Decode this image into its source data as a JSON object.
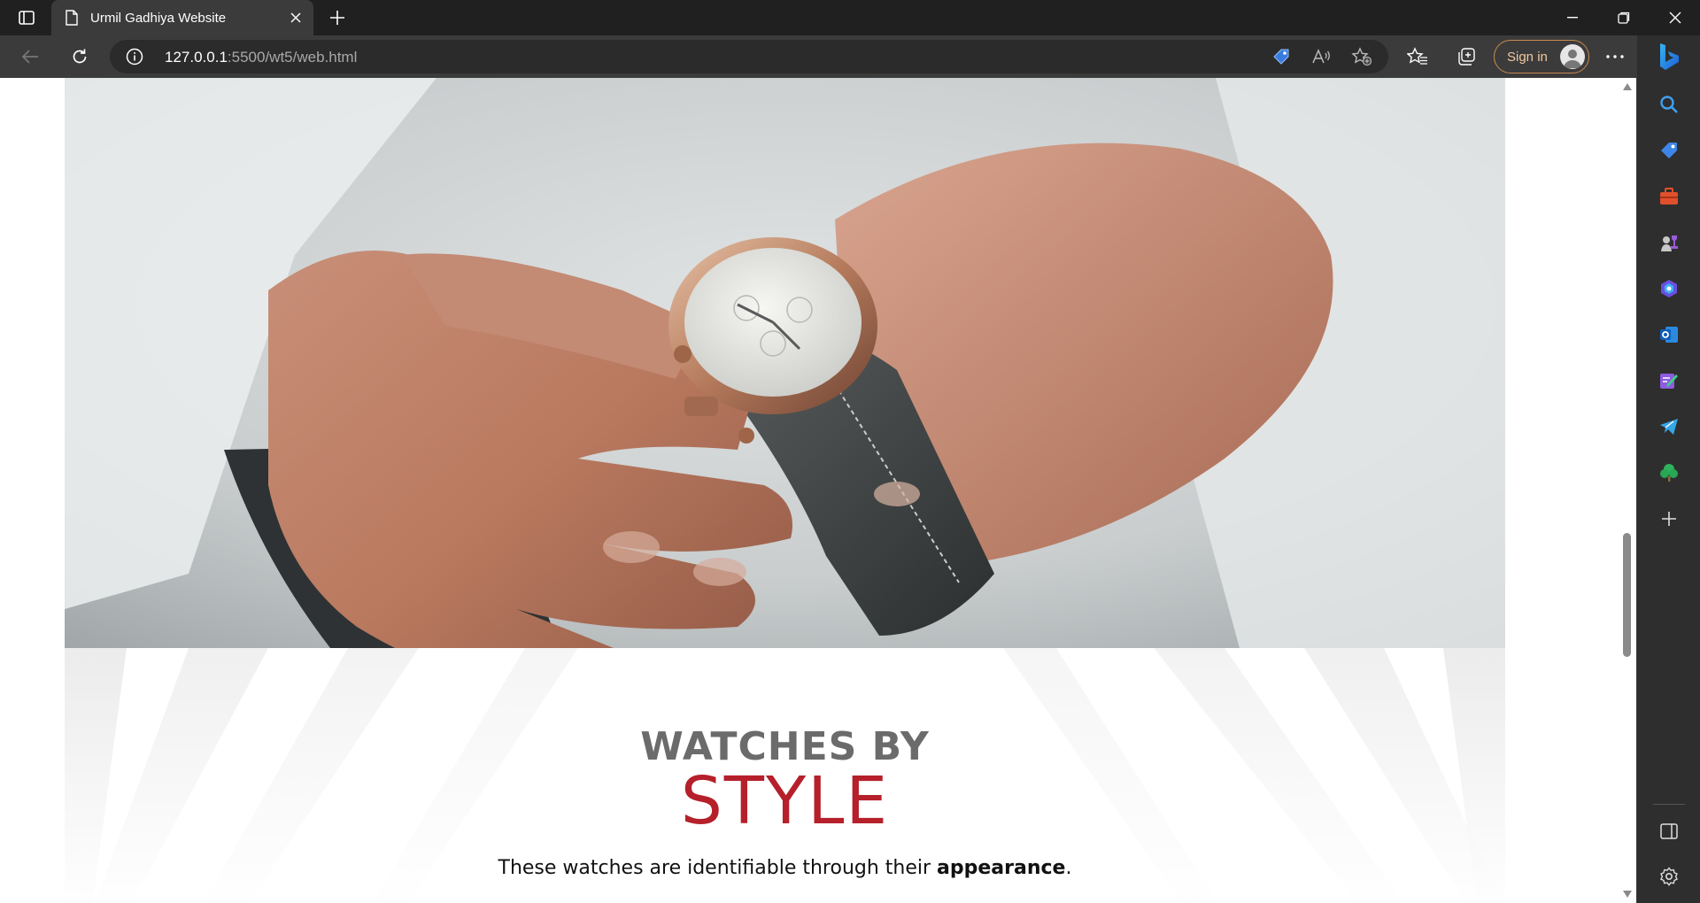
{
  "browser": {
    "tab": {
      "title": "Urmil Gadhiya Website"
    },
    "address": {
      "host": "127.0.0.1",
      "path": ":5500/wt5/web.html"
    },
    "signin_label": "Sign in"
  },
  "page": {
    "style_section": {
      "heading_small": "WATCHES BY",
      "heading_big": "STYLE",
      "tagline_prefix": "These watches are identifiable through their ",
      "tagline_bold": "appearance",
      "tagline_suffix": "."
    }
  },
  "icons": {
    "tab_actions": "tab-actions-icon",
    "page": "page-icon",
    "close": "close-icon",
    "new_tab": "plus-icon",
    "minimize": "minimize-icon",
    "restore": "restore-icon",
    "window_close": "close-icon",
    "back": "back-arrow-icon",
    "refresh": "refresh-icon",
    "info": "info-icon",
    "shopping": "shopping-tag-icon",
    "read_aloud": "read-aloud-icon",
    "add_favorite": "add-favorite-icon",
    "favorites": "favorites-icon",
    "collections": "collections-icon",
    "more": "more-icon",
    "bing": "bing-icon",
    "sidebar": [
      "search-icon",
      "shopping-tag-icon",
      "tools-icon",
      "games-icon",
      "copilot-icon",
      "outlook-icon",
      "designer-icon",
      "telegram-icon",
      "tree-icon",
      "add-icon",
      "split-screen-icon",
      "settings-icon"
    ]
  },
  "colors": {
    "accent_red": "#b5202a",
    "heading_gray": "#6b6b6b",
    "signin_border": "#c98a4e"
  }
}
